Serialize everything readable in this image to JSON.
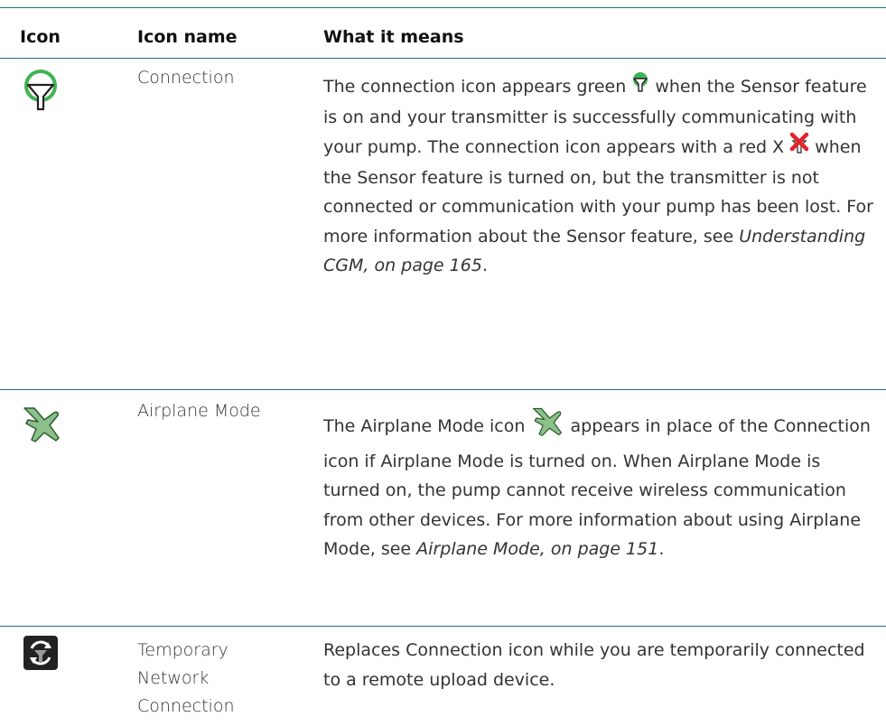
{
  "table": {
    "headers": {
      "icon": "Icon",
      "icon_name": "Icon name",
      "meaning": "What it means"
    },
    "rows": [
      {
        "icon": "connection-icon",
        "name": "Connection",
        "desc_1": "The connection icon appears green ",
        "desc_2": " when the Sensor feature is on and your transmitter is successfully communicating with your pump. The connection icon appears with a red X ",
        "desc_3": " when the Sensor feature is turned on, but the transmitter is not connected or communication with your pump has been lost. For more information about the Sensor feature, see ",
        "link": "Understanding CGM, on page 165",
        "desc_end": "."
      },
      {
        "icon": "airplane-icon",
        "name": "Airplane Mode",
        "desc_1": "The Airplane Mode icon ",
        "desc_2": " appears in place of the Connection icon if Airplane Mode is turned on. When Airplane Mode is turned on, the pump cannot receive wireless communication from other devices. For more information about using Airplane Mode, see ",
        "link": "Airplane Mode, on page 151",
        "desc_end": "."
      },
      {
        "icon": "temporary-network-connection-icon",
        "name": "Temporary Network Connection",
        "desc_1": "Replaces Connection icon while you are temporarily connected to a remote upload device."
      }
    ]
  },
  "colors": {
    "rule": "#1f6a8a",
    "connection_green": "#3fb34f",
    "airplane_green": "#8cc08a",
    "red_x": "#e0242a"
  }
}
